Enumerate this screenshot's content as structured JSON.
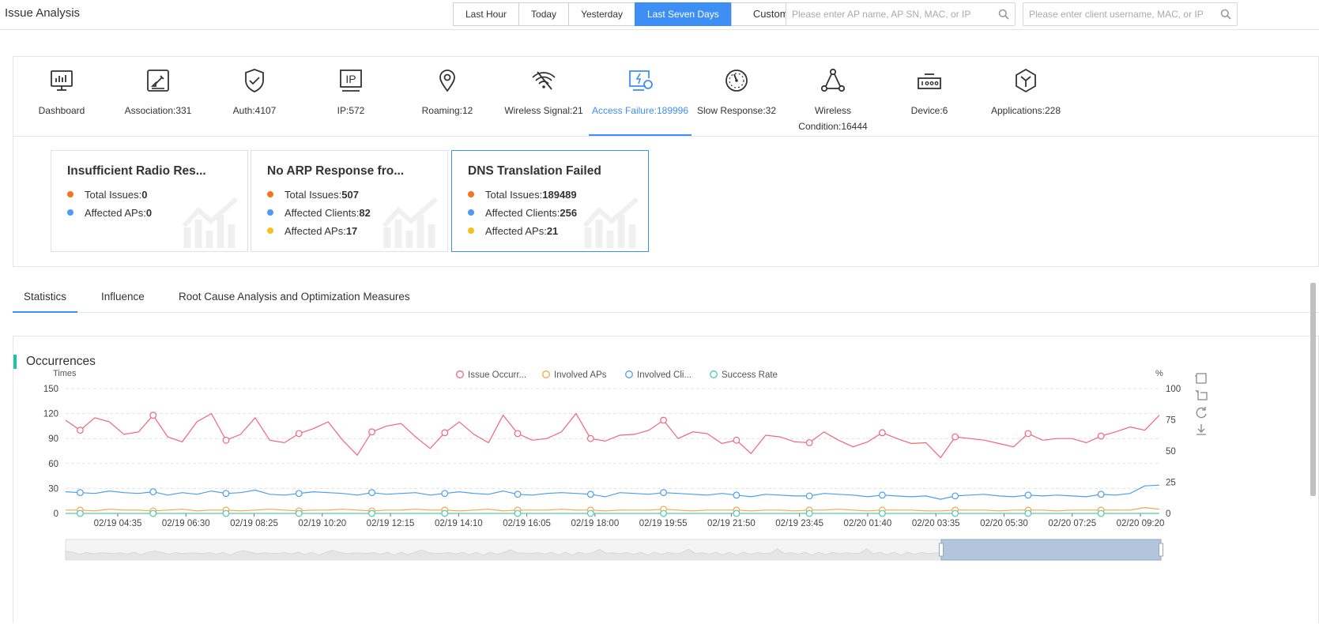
{
  "header": {
    "title": "Issue Analysis",
    "ranges": [
      "Last Hour",
      "Today",
      "Yesterday",
      "Last Seven Days",
      "Custom"
    ],
    "active_range": "Last Seven Days",
    "ap_search_placeholder": "Please enter AP name, AP SN, MAC, or IP",
    "client_search_placeholder": "Please enter client username, MAC, or IP"
  },
  "categories": [
    {
      "label": "Dashboard",
      "icon": "dashboard-icon"
    },
    {
      "label": "Association:331",
      "icon": "association-icon"
    },
    {
      "label": "Auth:4107",
      "icon": "shield-check-icon"
    },
    {
      "label": "IP:572",
      "icon": "ip-icon"
    },
    {
      "label": "Roaming:12",
      "icon": "location-pin-icon"
    },
    {
      "label": "Wireless Signal:21",
      "icon": "wifi-off-icon"
    },
    {
      "label": "Access Failure:189996",
      "icon": "access-failure-icon"
    },
    {
      "label": "Slow Response:32",
      "icon": "gauge-icon"
    },
    {
      "label": "Wireless Condition:16444",
      "icon": "network-topology-icon"
    },
    {
      "label": "Device:6",
      "icon": "device-icon"
    },
    {
      "label": "Applications:228",
      "icon": "cube-icon"
    }
  ],
  "active_category": "Access Failure:189996",
  "issue_cards": [
    {
      "title": "Insufficient Radio Res...",
      "metrics": [
        {
          "label": "Total Issues:",
          "value": "0",
          "color": "#f07524"
        },
        {
          "label": "Affected APs:",
          "value": "0",
          "color": "#4c9bf5"
        }
      ]
    },
    {
      "title": "No ARP Response fro...",
      "metrics": [
        {
          "label": "Total Issues:",
          "value": "507",
          "color": "#f07524"
        },
        {
          "label": "Affected Clients:",
          "value": "82",
          "color": "#4c9bf5"
        },
        {
          "label": "Affected APs:",
          "value": "17",
          "color": "#f5c11e"
        }
      ]
    },
    {
      "title": "DNS Translation Failed",
      "metrics": [
        {
          "label": "Total Issues:",
          "value": "189489",
          "color": "#f07524"
        },
        {
          "label": "Affected Clients:",
          "value": "256",
          "color": "#4c9bf5"
        },
        {
          "label": "Affected APs:",
          "value": "21",
          "color": "#f5c11e"
        }
      ]
    }
  ],
  "selected_card": "DNS Translation Failed",
  "tabs": [
    "Statistics",
    "Influence",
    "Root Cause Analysis and Optimization Measures"
  ],
  "active_tab": "Statistics",
  "section_title": "Occurrences",
  "chart_data": {
    "type": "line",
    "title": "",
    "ylabel_left": "Times",
    "ylabel_right": "%",
    "ylim_left": [
      0,
      150
    ],
    "yticks_left": [
      0,
      30,
      60,
      90,
      120,
      150
    ],
    "ylim_right": [
      0,
      100
    ],
    "yticks_right": [
      0,
      25,
      50,
      75,
      100
    ],
    "x_tick_labels": [
      "02/19 04:35",
      "02/19 06:30",
      "02/19 08:25",
      "02/19 10:20",
      "02/19 12:15",
      "02/19 14:10",
      "02/19 16:05",
      "02/19 18:00",
      "02/19 19:55",
      "02/19 21:50",
      "02/19 23:45",
      "02/20 01:40",
      "02/20 03:35",
      "02/20 05:30",
      "02/20 07:25",
      "02/20 09:20"
    ],
    "legend_position": "top-center",
    "grid": "horizontal dashed",
    "series": [
      {
        "name": "Issue Occurr...",
        "axis": "left",
        "color": "#f2657b",
        "values": [
          112,
          100,
          115,
          110,
          95,
          98,
          118,
          92,
          86,
          110,
          120,
          88,
          95,
          115,
          88,
          85,
          96,
          102,
          110,
          88,
          70,
          98,
          105,
          108,
          92,
          78,
          97,
          110,
          95,
          85,
          118,
          96,
          88,
          90,
          98,
          120,
          90,
          87,
          94,
          95,
          100,
          112,
          90,
          98,
          96,
          84,
          88,
          72,
          94,
          92,
          86,
          85,
          98,
          88,
          80,
          86,
          97,
          90,
          84,
          85,
          67,
          92,
          90,
          88,
          84,
          80,
          96,
          88,
          90,
          90,
          85,
          93,
          98,
          104,
          100,
          118
        ]
      },
      {
        "name": "Involved APs",
        "axis": "left",
        "color": "#f5a54a",
        "values": [
          4,
          4,
          3,
          5,
          4,
          4,
          3,
          4,
          5,
          3,
          4,
          4,
          3,
          4,
          5,
          4,
          3,
          4,
          4,
          5,
          4,
          3,
          4,
          4,
          5,
          4,
          4,
          3,
          4,
          5,
          3,
          4,
          4,
          4,
          5,
          4,
          4,
          3,
          4,
          4,
          4,
          5,
          4,
          3,
          4,
          4,
          4,
          3,
          4,
          4,
          3,
          4,
          4,
          5,
          4,
          3,
          4,
          4,
          4,
          3,
          3,
          4,
          4,
          4,
          3,
          4,
          4,
          4,
          3,
          4,
          4,
          4,
          4,
          4,
          7,
          5
        ]
      },
      {
        "name": "Involved Cli...",
        "axis": "left",
        "color": "#4a9ef0",
        "values": [
          26,
          25,
          24,
          27,
          25,
          24,
          26,
          22,
          25,
          23,
          27,
          24,
          25,
          28,
          23,
          22,
          24,
          26,
          25,
          24,
          22,
          25,
          23,
          24,
          25,
          22,
          24,
          26,
          24,
          23,
          27,
          23,
          22,
          24,
          25,
          24,
          23,
          20,
          25,
          24,
          23,
          25,
          24,
          23,
          22,
          24,
          22,
          20,
          23,
          22,
          21,
          21,
          24,
          23,
          22,
          20,
          22,
          21,
          20,
          21,
          17,
          21,
          22,
          23,
          21,
          20,
          22,
          21,
          22,
          21,
          20,
          23,
          22,
          24,
          33,
          34
        ]
      },
      {
        "name": "Success Rate",
        "axis": "right",
        "color": "#4fc9aa",
        "values": [
          0,
          0,
          0,
          0,
          0,
          0,
          0,
          0,
          0,
          0,
          0,
          0,
          0,
          0,
          0,
          0,
          0,
          0,
          0,
          0,
          0,
          0,
          0,
          0,
          0,
          0,
          0,
          0,
          0,
          0,
          0,
          0,
          0,
          0,
          0,
          0,
          0,
          0,
          0,
          0,
          0,
          0,
          0,
          0,
          0,
          0,
          0,
          0,
          0,
          0,
          0,
          0,
          0,
          0,
          0,
          0,
          0,
          0,
          0,
          0,
          0,
          0,
          0,
          0,
          0,
          0,
          0,
          0,
          0,
          0,
          0,
          0,
          0,
          0,
          0,
          0
        ]
      }
    ]
  }
}
